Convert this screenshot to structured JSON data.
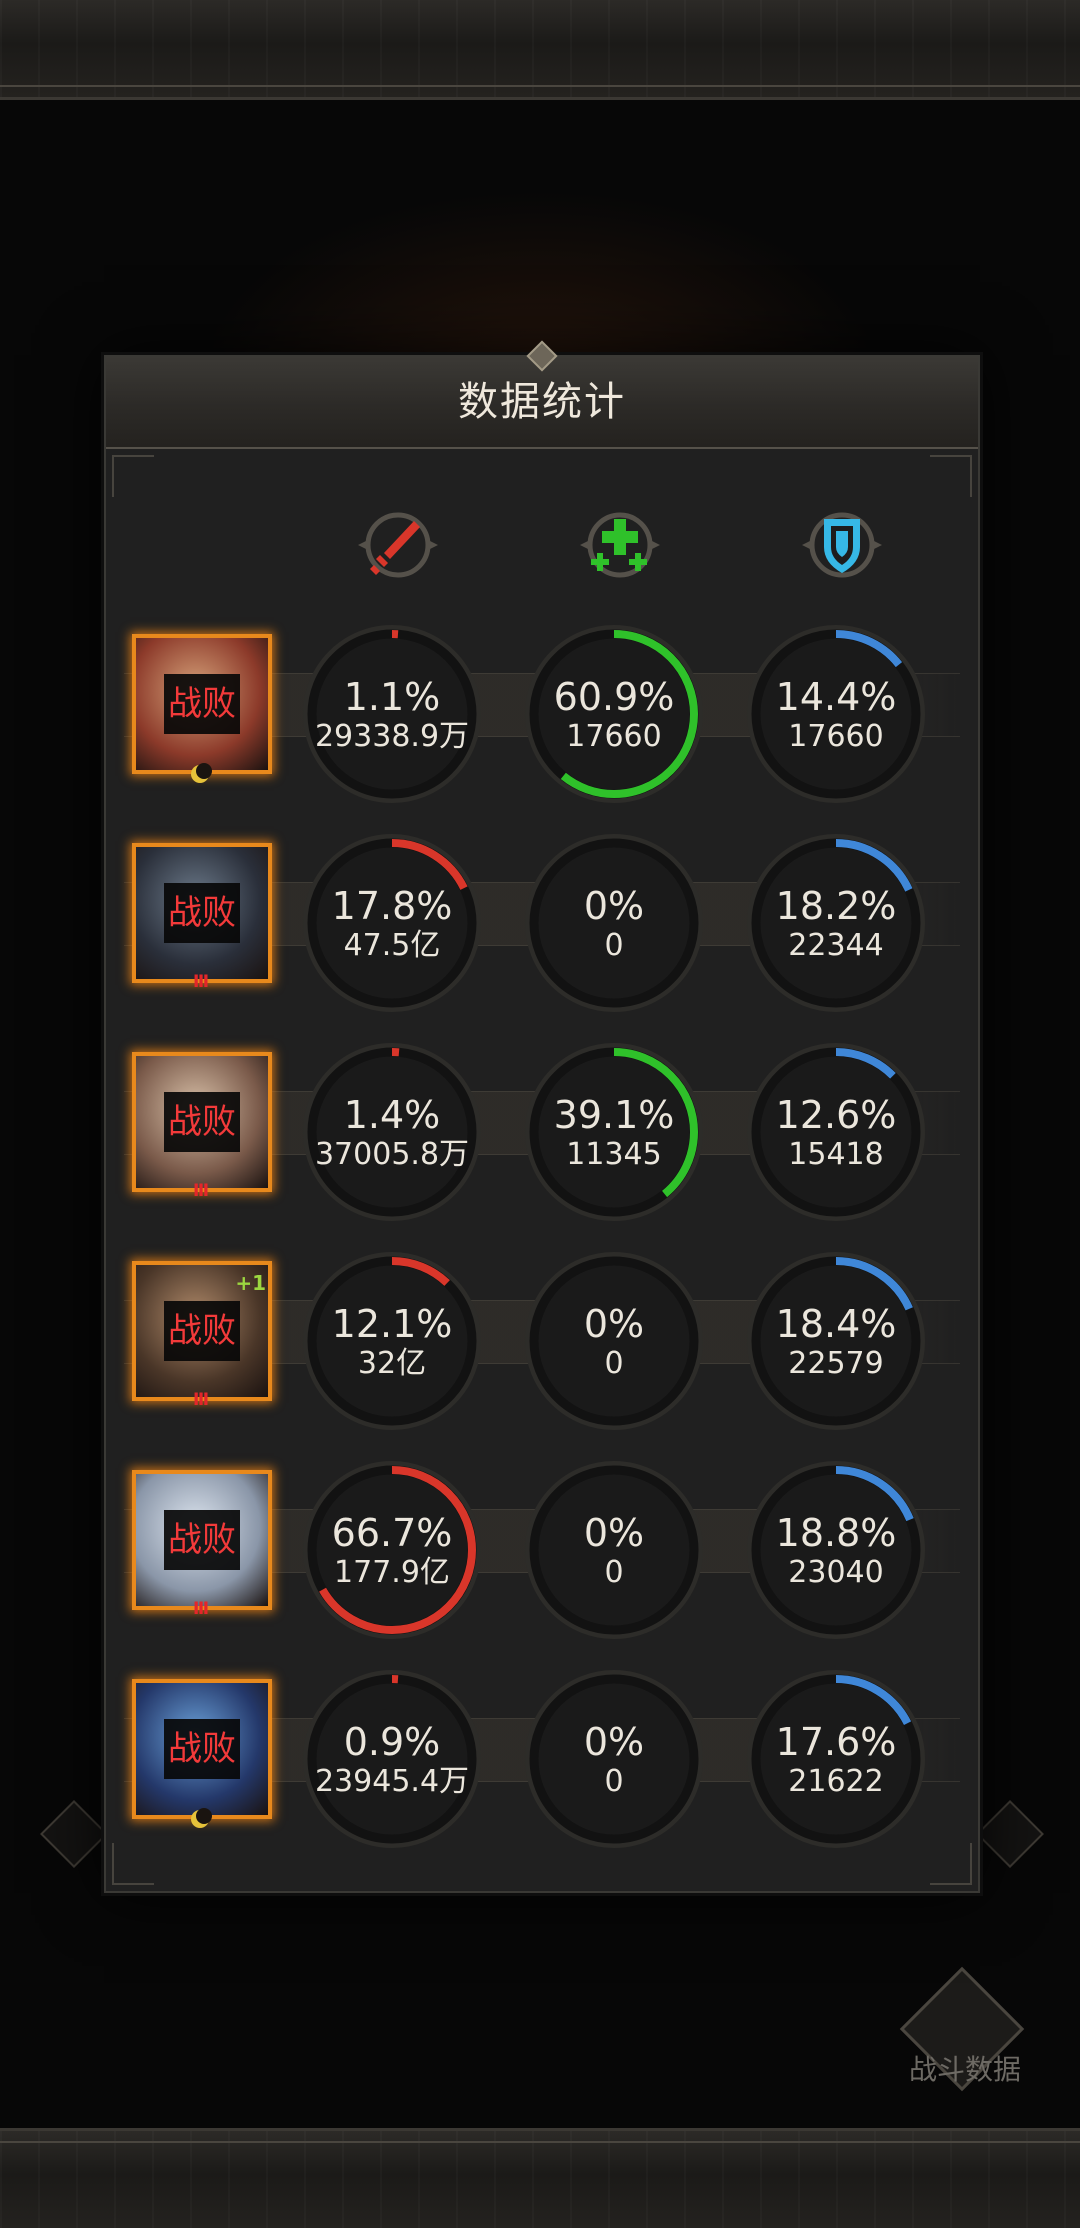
{
  "dialog": {
    "title": "数据统计"
  },
  "background": {
    "battle_data_label": "战斗数据"
  },
  "columns": [
    {
      "icon": "sword-damage-icon",
      "color": "#d9362a"
    },
    {
      "icon": "heal-cross-icon",
      "color": "#2fc12a"
    },
    {
      "icon": "shield-icon",
      "color": "#3f87d8"
    }
  ],
  "heroes": [
    {
      "status": "战败",
      "badge": "moon",
      "plus": "",
      "damage": {
        "percent": "1.1%",
        "value": "29338.9万",
        "fraction": 0.011
      },
      "heal": {
        "percent": "60.9%",
        "value": "17660",
        "fraction": 0.609
      },
      "tank": {
        "percent": "14.4%",
        "value": "17660",
        "fraction": 0.144
      }
    },
    {
      "status": "战败",
      "badge": "III",
      "plus": "",
      "damage": {
        "percent": "17.8%",
        "value": "47.5亿",
        "fraction": 0.178
      },
      "heal": {
        "percent": "0%",
        "value": "0",
        "fraction": 0
      },
      "tank": {
        "percent": "18.2%",
        "value": "22344",
        "fraction": 0.182
      }
    },
    {
      "status": "战败",
      "badge": "III",
      "plus": "",
      "damage": {
        "percent": "1.4%",
        "value": "37005.8万",
        "fraction": 0.014
      },
      "heal": {
        "percent": "39.1%",
        "value": "11345",
        "fraction": 0.391
      },
      "tank": {
        "percent": "12.6%",
        "value": "15418",
        "fraction": 0.126
      }
    },
    {
      "status": "战败",
      "badge": "III",
      "plus": "+1",
      "damage": {
        "percent": "12.1%",
        "value": "32亿",
        "fraction": 0.121
      },
      "heal": {
        "percent": "0%",
        "value": "0",
        "fraction": 0
      },
      "tank": {
        "percent": "18.4%",
        "value": "22579",
        "fraction": 0.184
      }
    },
    {
      "status": "战败",
      "badge": "III",
      "plus": "",
      "damage": {
        "percent": "66.7%",
        "value": "177.9亿",
        "fraction": 0.667
      },
      "heal": {
        "percent": "0%",
        "value": "0",
        "fraction": 0
      },
      "tank": {
        "percent": "18.8%",
        "value": "23040",
        "fraction": 0.188
      }
    },
    {
      "status": "战败",
      "badge": "moon",
      "plus": "",
      "damage": {
        "percent": "0.9%",
        "value": "23945.4万",
        "fraction": 0.009
      },
      "heal": {
        "percent": "0%",
        "value": "0",
        "fraction": 0
      },
      "tank": {
        "percent": "17.6%",
        "value": "21622",
        "fraction": 0.176
      }
    }
  ]
}
